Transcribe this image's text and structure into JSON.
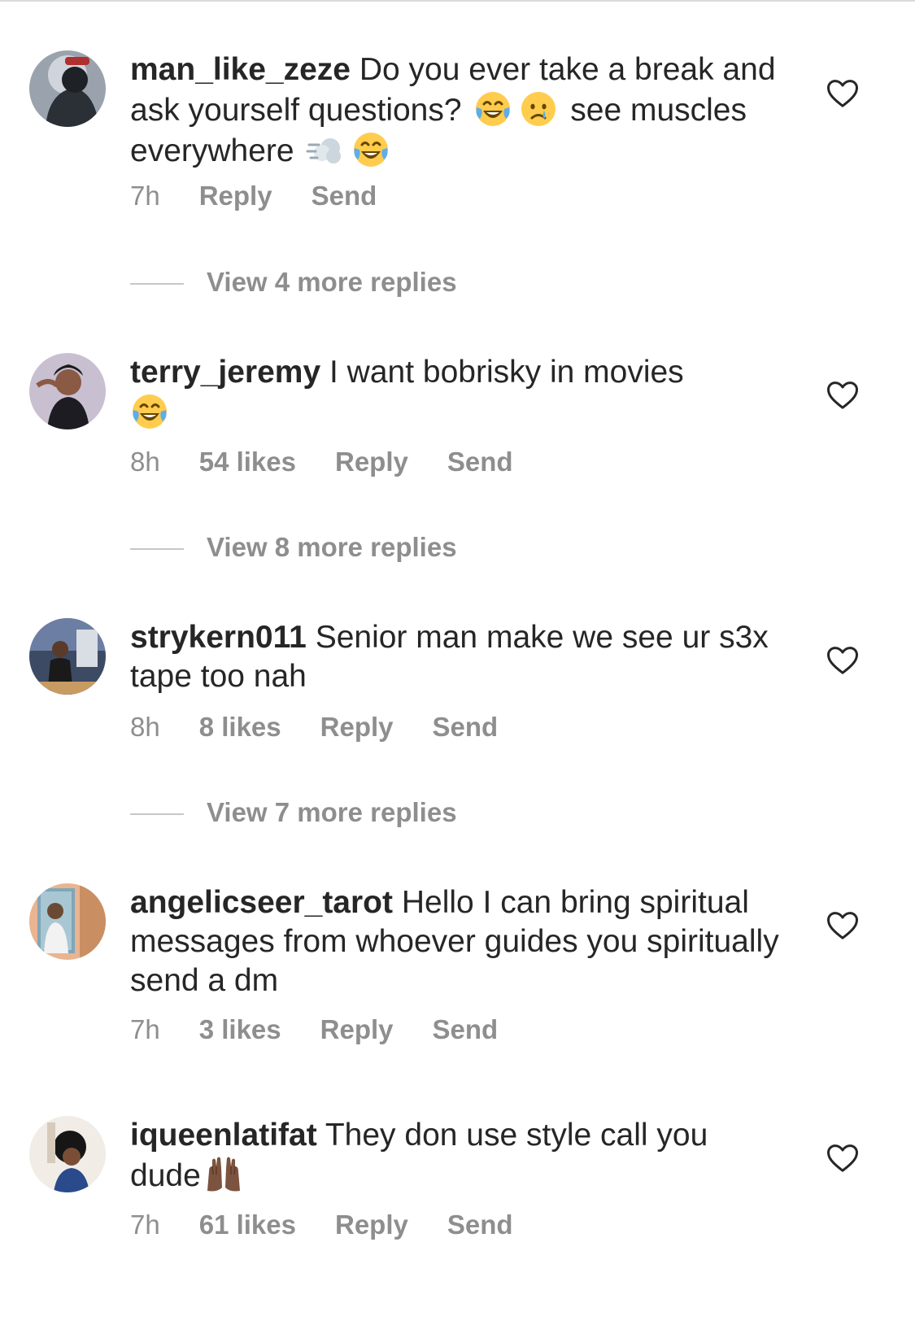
{
  "comments": [
    {
      "username": "man_like_zeze",
      "text_1": "Do you ever take a break and ask yourself questions?",
      "text_2": "see muscles everywhere",
      "time": "7h",
      "likes": "",
      "reply_label": "Reply",
      "send_label": "Send",
      "view_replies": "View 4 more replies"
    },
    {
      "username": "terry_jeremy",
      "text_1": "I want bobrisky in movies",
      "time": "8h",
      "likes": "54 likes",
      "reply_label": "Reply",
      "send_label": "Send",
      "view_replies": "View 8 more replies"
    },
    {
      "username": "strykern011",
      "text_1": "Senior man make we see ur s3x tape too nah",
      "time": "8h",
      "likes": "8 likes",
      "reply_label": "Reply",
      "send_label": "Send",
      "view_replies": "View 7 more replies"
    },
    {
      "username": "angelicseer_tarot",
      "text_1": "Hello I can bring spiritual messages from whoever guides you spiritually send a dm",
      "time": "7h",
      "likes": "3 likes",
      "reply_label": "Reply",
      "send_label": "Send"
    },
    {
      "username": "iqueenlatifat",
      "text_1": "They don use style call you dude",
      "time": "7h",
      "likes": "61 likes",
      "reply_label": "Reply",
      "send_label": "Send"
    }
  ],
  "icons": {
    "like": "heart-outline-icon",
    "laugh": "tears-of-joy-emoji",
    "cry": "crying-face-emoji",
    "dash": "dashing-away-emoji",
    "hands": "raised-hands-emoji"
  },
  "colors": {
    "text": "#262626",
    "muted": "#8e8e8e",
    "divider": "#c7c7c7"
  }
}
